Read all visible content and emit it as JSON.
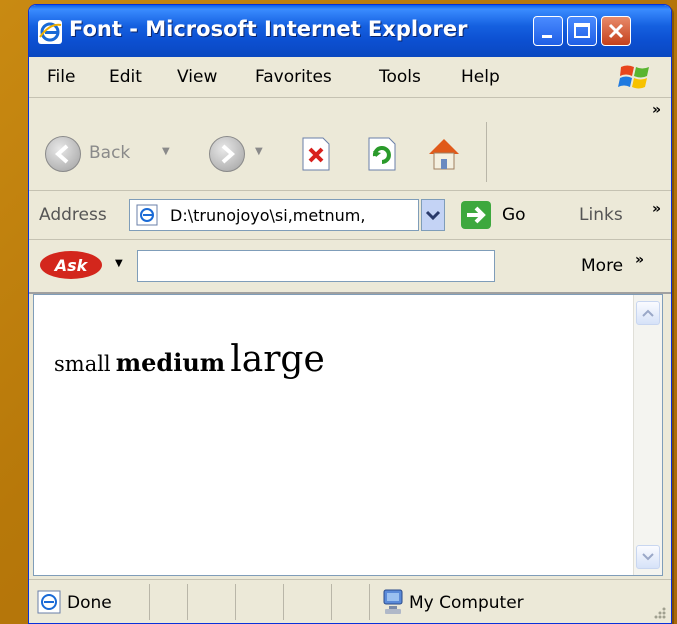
{
  "window": {
    "title": "Font - Microsoft Internet Explorer"
  },
  "menu": {
    "items": [
      "File",
      "Edit",
      "View",
      "Favorites",
      "Tools",
      "Help"
    ]
  },
  "toolbar": {
    "back_label": "Back"
  },
  "address": {
    "label": "Address",
    "value": "D:\\trunojoyo\\si,metnum,",
    "go_label": "Go",
    "links_label": "Links"
  },
  "askbar": {
    "logo_text": "Ask",
    "search_value": "",
    "more_label": "More"
  },
  "content": {
    "small": "small",
    "medium": "medium",
    "large": "large"
  },
  "status": {
    "text": "Done",
    "zone": "My Computer"
  }
}
